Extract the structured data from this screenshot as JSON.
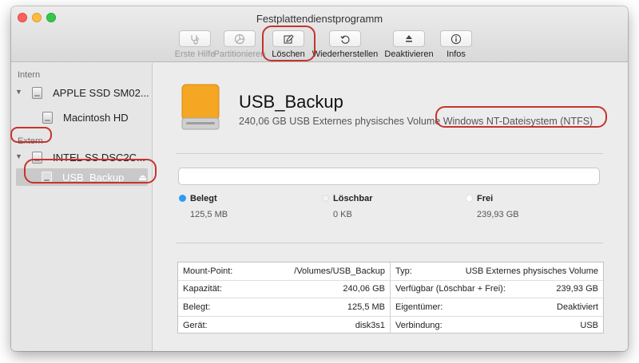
{
  "window": {
    "title": "Festplattendienstprogramm"
  },
  "toolbar": [
    {
      "label": "Erste Hilfe",
      "icon": "stethoscope-icon",
      "enabled": false
    },
    {
      "label": "Partitionieren",
      "icon": "pie-chart-icon",
      "enabled": false
    },
    {
      "label": "Löschen",
      "icon": "erase-icon",
      "enabled": true
    },
    {
      "label": "Wiederherstellen",
      "icon": "restore-icon",
      "enabled": true
    },
    {
      "label": "Deaktivieren",
      "icon": "eject-icon",
      "enabled": true
    },
    {
      "label": "Infos",
      "icon": "info-icon",
      "enabled": true
    }
  ],
  "sidebar": {
    "section_internal": "Intern",
    "section_external": "Extern",
    "items": [
      {
        "label": "APPLE SSD SM02..."
      },
      {
        "label": "Macintosh HD"
      },
      {
        "label": "INTEL SS DSC2C..."
      },
      {
        "label": "USB_Backup"
      }
    ]
  },
  "volume": {
    "name": "USB_Backup",
    "description": "240,06 GB USB Externes physisches Volume",
    "filesystem": "Windows NT-Dateisystem (NTFS)"
  },
  "usage": [
    {
      "label": "Belegt",
      "value": "125,5 MB",
      "color": "#2f9bf0"
    },
    {
      "label": "Löschbar",
      "value": "0 KB",
      "color": "#f2f2f2"
    },
    {
      "label": "Frei",
      "value": "239,93 GB",
      "color": "#ffffff"
    }
  ],
  "info": {
    "left": [
      {
        "key": "Mount-Point:",
        "value": "/Volumes/USB_Backup"
      },
      {
        "key": "Kapazität:",
        "value": "240,06 GB"
      },
      {
        "key": "Belegt:",
        "value": "125,5 MB"
      },
      {
        "key": "Gerät:",
        "value": "disk3s1"
      }
    ],
    "right": [
      {
        "key": "Typ:",
        "value": "USB Externes physisches Volume"
      },
      {
        "key": "Verfügbar (Löschbar + Frei):",
        "value": "239,93 GB"
      },
      {
        "key": "Eigentümer:",
        "value": "Deaktiviert"
      },
      {
        "key": "Verbindung:",
        "value": "USB"
      }
    ]
  },
  "colors": {
    "highlight": "#c6332e",
    "selection": "#c9c9c9",
    "drive": "#f5a623"
  }
}
